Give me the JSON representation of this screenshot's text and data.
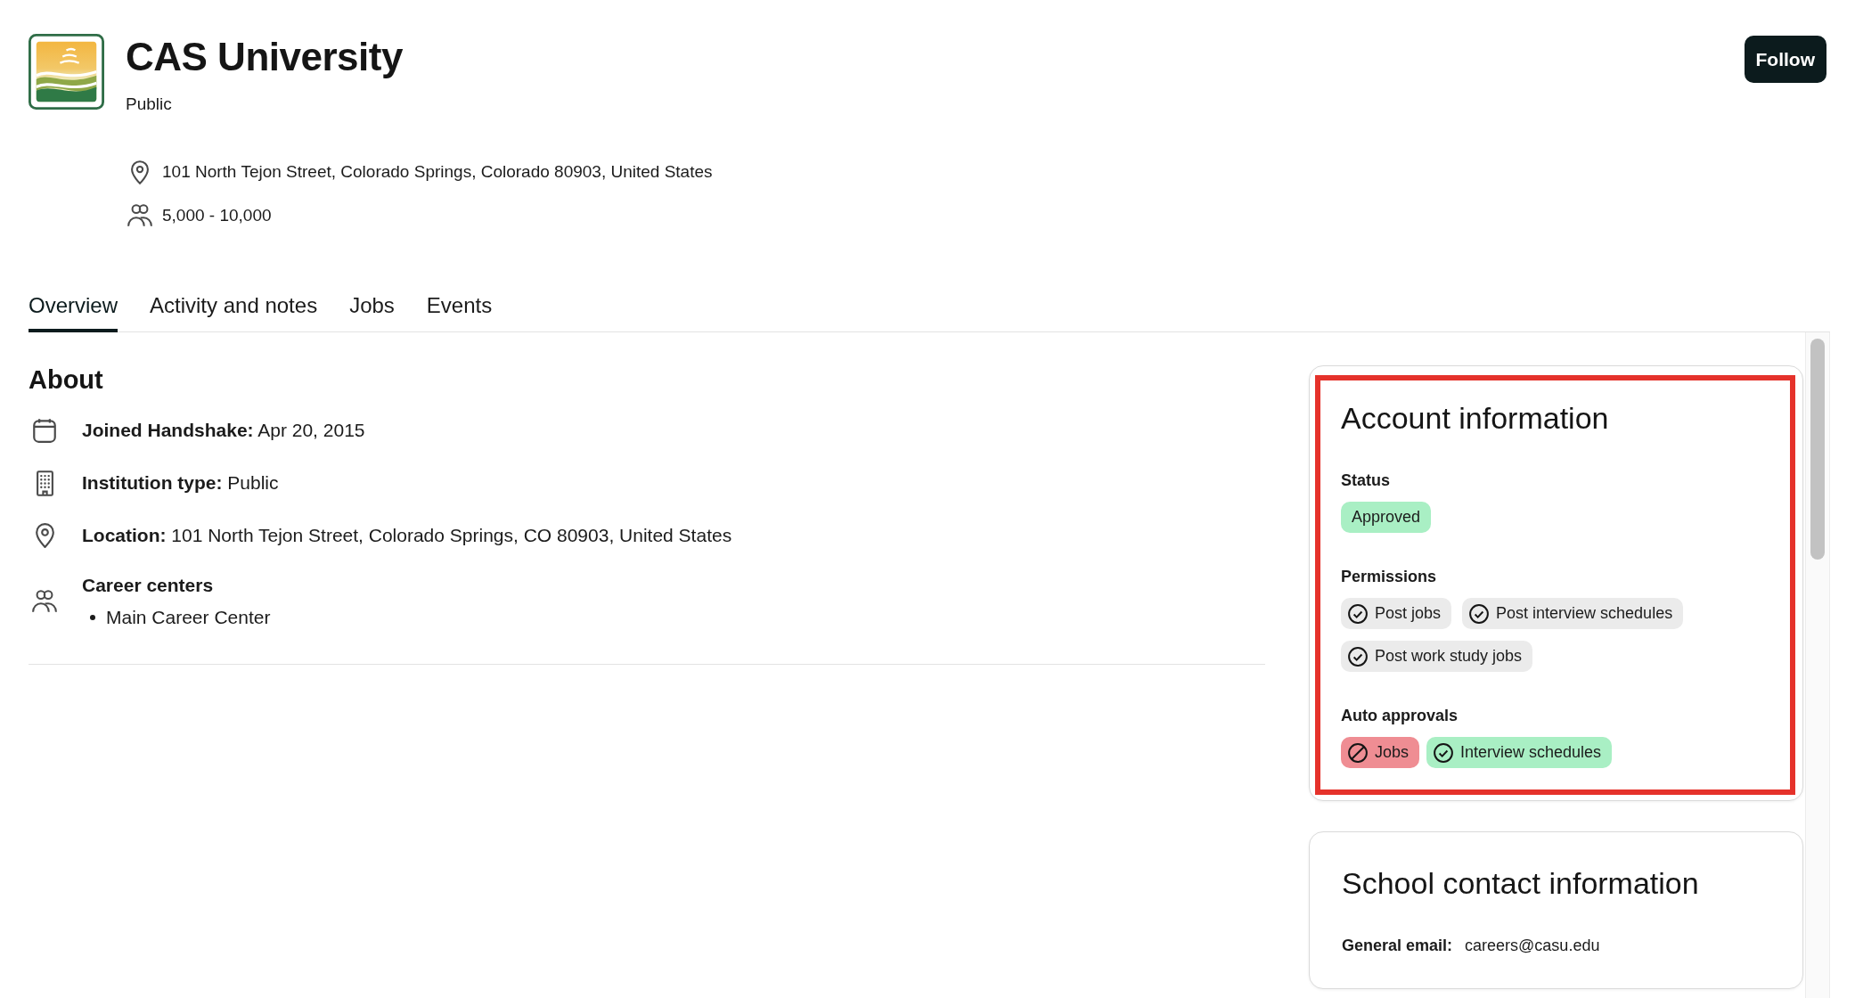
{
  "header": {
    "name": "CAS University",
    "type": "Public",
    "address": "101 North Tejon Street, Colorado Springs, Colorado 80903, United States",
    "employees": "5,000 - 10,000",
    "follow_button": "Follow"
  },
  "tabs": [
    {
      "label": "Overview",
      "selected": true
    },
    {
      "label": "Activity and notes",
      "selected": false
    },
    {
      "label": "Jobs",
      "selected": false
    },
    {
      "label": "Events",
      "selected": false
    }
  ],
  "about": {
    "title": "About",
    "joined": {
      "label": "Joined Handshake:",
      "value": "Apr 20, 2015"
    },
    "institution_type": {
      "label": "Institution type:",
      "value": "Public"
    },
    "location": {
      "label": "Location:",
      "value": "101 North Tejon Street, Colorado Springs, CO 80903, United States"
    },
    "career_centers": {
      "label": "Career centers",
      "items": [
        "Main Career Center"
      ]
    }
  },
  "account_information": {
    "title": "Account information",
    "highlighted": true,
    "status": {
      "label": "Status",
      "value": "Approved"
    },
    "permissions": {
      "label": "Permissions",
      "items": [
        {
          "label": "Post jobs",
          "enabled": true
        },
        {
          "label": "Post interview schedules",
          "enabled": true
        },
        {
          "label": "Post work study jobs",
          "enabled": true
        }
      ]
    },
    "auto_approvals": {
      "label": "Auto approvals",
      "items": [
        {
          "label": "Jobs",
          "enabled": false
        },
        {
          "label": "Interview schedules",
          "enabled": true
        }
      ]
    }
  },
  "school_contact_information": {
    "title": "School contact information",
    "general_email": {
      "label": "General email:",
      "value": "careers@casu.edu"
    }
  }
}
